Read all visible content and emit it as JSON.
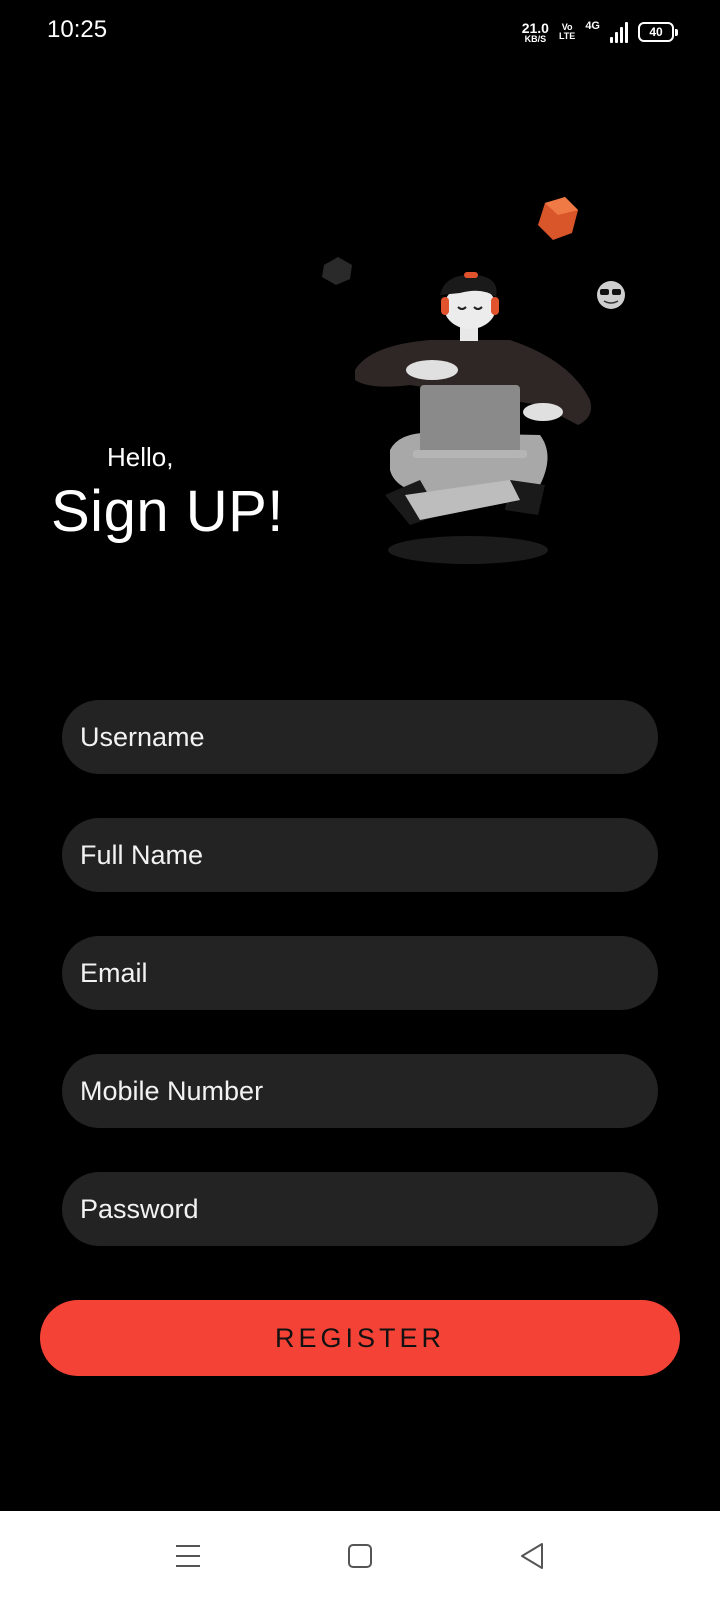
{
  "status_bar": {
    "time": "10:25",
    "net_speed_value": "21.0",
    "net_speed_unit": "KB/S",
    "volte_top": "Vo",
    "volte_bottom": "LTE",
    "network_type": "4G",
    "battery_level": "40"
  },
  "header": {
    "greeting": "Hello,",
    "headline": "Sign UP!"
  },
  "form": {
    "username_placeholder": "Username",
    "full_name_placeholder": "Full Name",
    "email_placeholder": "Email",
    "mobile_placeholder": "Mobile Number",
    "password_placeholder": "Password",
    "register_label": "REGISTER"
  },
  "colors": {
    "background": "#000000",
    "field_background": "#232323",
    "accent": "#f44336",
    "nav_bar": "#ffffff"
  },
  "icons": {
    "nav_menu": "menu-icon",
    "nav_home": "home-square-icon",
    "nav_back": "back-triangle-icon"
  }
}
